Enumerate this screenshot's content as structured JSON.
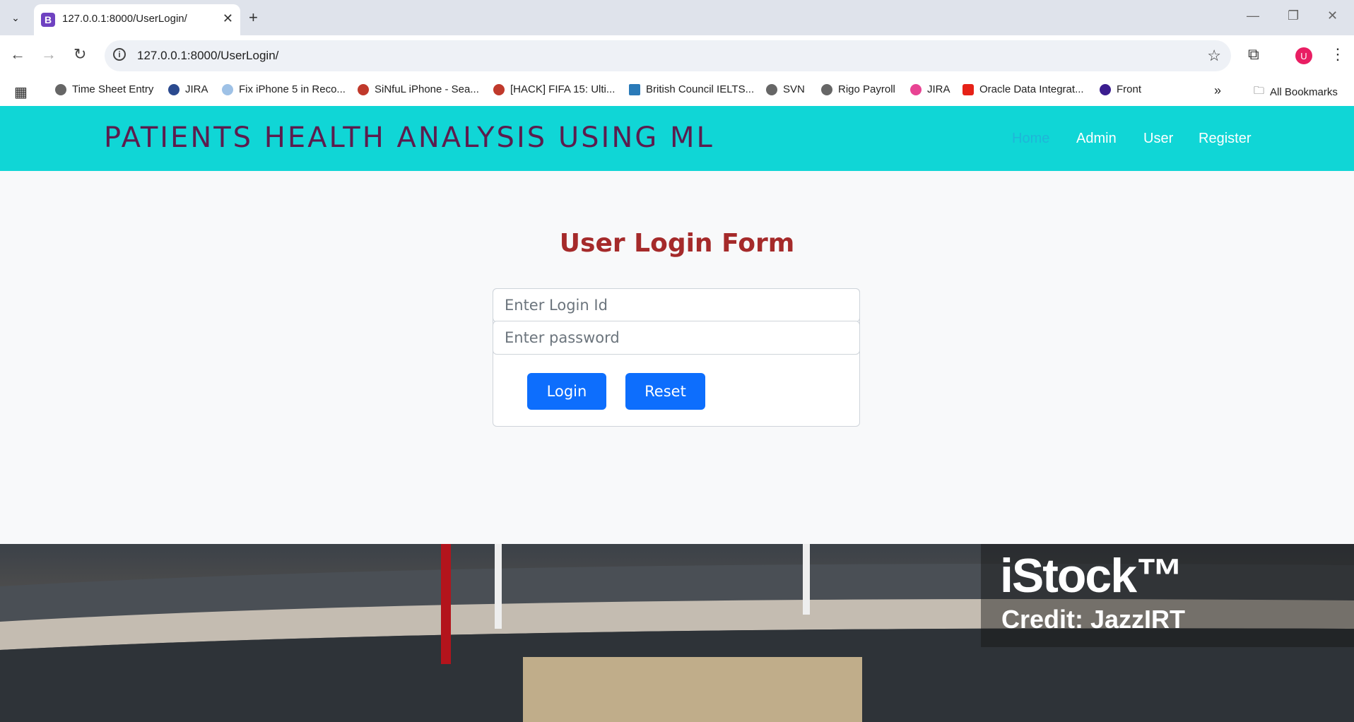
{
  "browser": {
    "tab_title": "127.0.0.1:8000/UserLogin/",
    "favicon_letter": "B",
    "url": "127.0.0.1:8000/UserLogin/",
    "profile_initial": "U",
    "bookmarks": [
      "Time Sheet Entry",
      "JIRA",
      "Fix iPhone 5 in Reco...",
      "SiNfuL iPhone - Sea...",
      "[HACK] FIFA 15: Ulti...",
      "British Council IELTS...",
      "SVN",
      "Rigo Payroll",
      "JIRA",
      "Oracle Data Integrat...",
      "Front"
    ],
    "all_bookmarks": "All Bookmarks"
  },
  "navbar": {
    "brand": "PATIENTS HEALTH ANALYSIS USING ML",
    "links": [
      "Home",
      "Admin",
      "User",
      "Register"
    ]
  },
  "form": {
    "title": "User Login Form",
    "login_placeholder": "Enter Login Id",
    "password_placeholder": "Enter password",
    "login_button": "Login",
    "reset_button": "Reset"
  },
  "banner": {
    "watermark_logo": "iStock™",
    "watermark_credit": "Credit: JazzIRT"
  },
  "colors": {
    "navbar_bg": "#10d6d6",
    "brand_color": "#5b1d4e",
    "title_color": "#a52a2a",
    "button_bg": "#0d6efd"
  }
}
